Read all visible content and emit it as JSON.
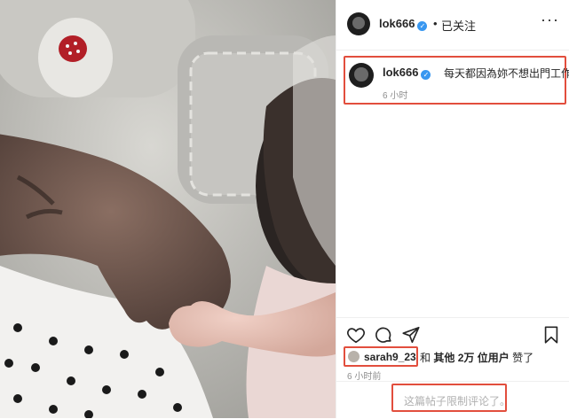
{
  "header": {
    "username": "lok666",
    "verified_glyph": "✓",
    "separator": "•",
    "follow_status": "已关注",
    "more_glyph": "···"
  },
  "caption": {
    "username": "lok666",
    "text": "每天都因為妳不想出門工作",
    "emoji": "❤️",
    "time": "6 小时"
  },
  "actions": {
    "like_icon": "heart-outline-icon",
    "comment_icon": "comment-bubble-icon",
    "share_icon": "paper-plane-icon",
    "save_icon": "bookmark-icon"
  },
  "likes": {
    "user": "sarah9_23",
    "connector": "和",
    "others_prefix": "其他",
    "count": "2万",
    "suffix": "位用户",
    "liked": "赞了"
  },
  "post_time": "6 小时前",
  "comments_restricted": "这篇帖子限制评论了。",
  "colors": {
    "highlight_red": "#e24e3d",
    "verified_blue": "#3897f0",
    "muted_text": "#8e8e8e",
    "heart_red": "#ed4956"
  }
}
